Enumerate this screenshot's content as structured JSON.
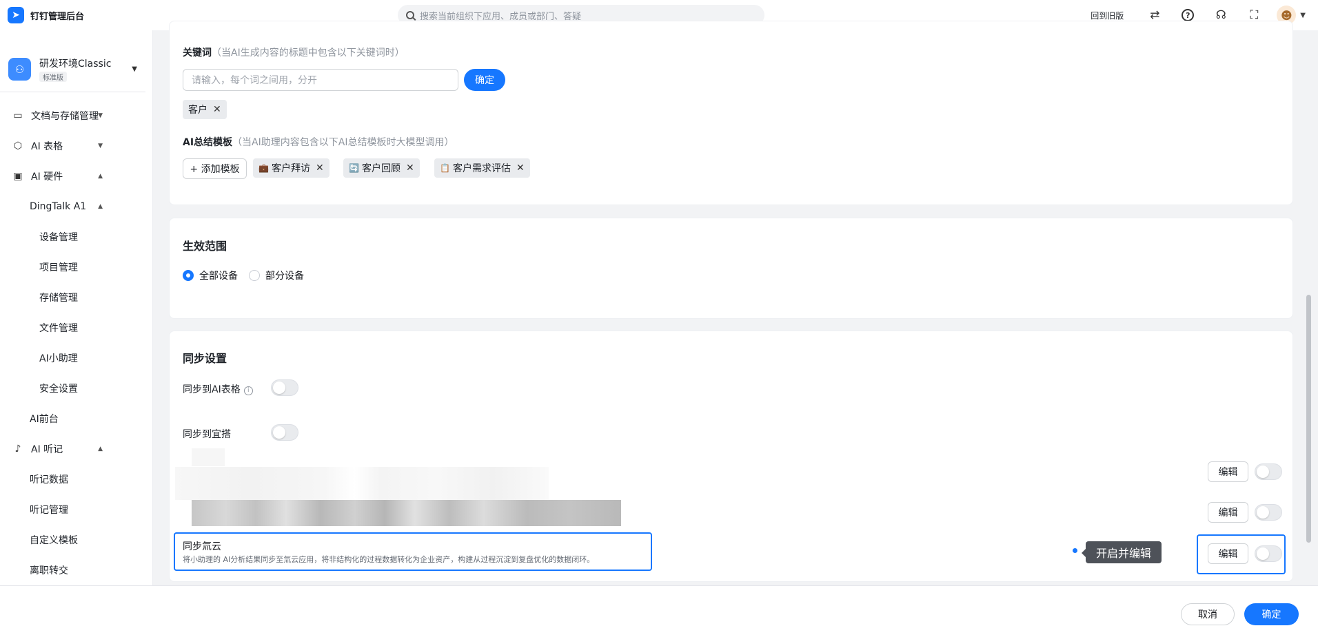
{
  "app": {
    "title": "钉钉管理后台"
  },
  "search": {
    "placeholder": "搜索当前组织下应用、成员或部门、答疑"
  },
  "topbar": {
    "back_old": "回到旧版"
  },
  "org": {
    "name": "研发环境Classic",
    "badge": "标准版"
  },
  "sidebar": {
    "items": [
      {
        "label": "文档与存储管理",
        "icon": "drive-icon"
      },
      {
        "label": "AI 表格",
        "icon": "cube-icon"
      },
      {
        "label": "AI 硬件",
        "icon": "hardware-icon"
      },
      {
        "label": "DingTalk A1"
      },
      {
        "label": "设备管理"
      },
      {
        "label": "项目管理"
      },
      {
        "label": "存储管理"
      },
      {
        "label": "文件管理"
      },
      {
        "label": "AI小助理"
      },
      {
        "label": "安全设置"
      },
      {
        "label": "AI前台"
      },
      {
        "label": "AI 听记",
        "icon": "mic-icon"
      },
      {
        "label": "听记数据"
      },
      {
        "label": "听记管理"
      },
      {
        "label": "自定义模板"
      },
      {
        "label": "离职转交"
      }
    ]
  },
  "keywords": {
    "label": "关键词",
    "hint": "（当AI生成内容的标题中包含以下关键词时）",
    "input_placeholder": "请输入，每个词之间用，分开",
    "confirm": "确定",
    "tags": [
      "客户"
    ]
  },
  "templates": {
    "label": "AI总结模板",
    "hint": "（当AI助理内容包含以下AI总结模板时大模型调用）",
    "add": "+ 添加模板",
    "items": [
      {
        "icon": "💼",
        "label": "客户拜访"
      },
      {
        "icon": "🔄",
        "label": "客户回顾"
      },
      {
        "icon": "📋",
        "label": "客户需求评估"
      }
    ]
  },
  "scope": {
    "title": "生效范围",
    "options": [
      "全部设备",
      "部分设备"
    ],
    "selected": "全部设备"
  },
  "sync": {
    "title": "同步设置",
    "ai_table": "同步到AI表格",
    "yida": "同步到宜搭",
    "edit": "编辑",
    "fenxiang": {
      "title": "同步氚云",
      "desc": "将小助理的 AI分析结果同步至氚云应用，将非结构化的过程数据转化为企业资产，构建从过程沉淀到复盘优化的数据闭环。"
    },
    "tooltip": "开启并编辑"
  },
  "footer": {
    "cancel": "取消",
    "ok": "确定"
  }
}
